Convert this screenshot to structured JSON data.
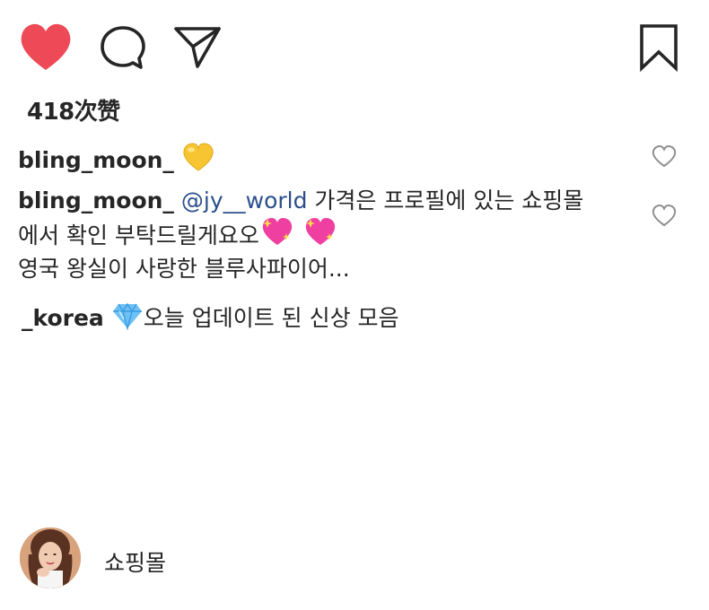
{
  "actions": {
    "like_icon": "heart-filled-icon",
    "comment_icon": "speech-bubble-icon",
    "share_icon": "paper-plane-icon",
    "bookmark_icon": "bookmark-icon",
    "like_color": "#ed4956"
  },
  "likes": {
    "label": "418次赞"
  },
  "comments": [
    {
      "username": "bling_moon_",
      "emoji": "yellow-heart"
    },
    {
      "username": "bling_moon_",
      "mention": "@jy__world",
      "text_line1": "가격은 프로필에 있는 쇼핑몰",
      "text_line2": "에서 확인 부탁드릴게요오"
    }
  ],
  "caption": {
    "line1": "영국 왕실이 사랑한 블루사파이어...",
    "username": "_korea",
    "line2_text": "오늘 업데이트 된 신상 모음"
  },
  "profile": {
    "label": "쇼핑몰"
  }
}
